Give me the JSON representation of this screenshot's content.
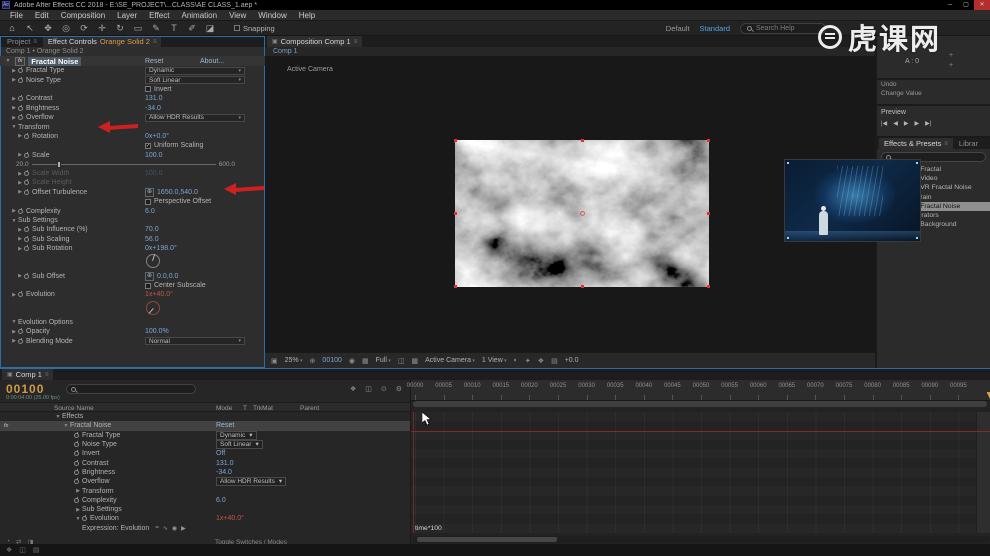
{
  "window": {
    "title": "Adobe After Effects CC 2018 - E:\\SE_PROJECT\\...CLASS\\AE CLASS_1.aep *",
    "controls": {
      "minimize": "─",
      "maximize": "▢",
      "close": "✕"
    }
  },
  "icons": {
    "menu": "≡",
    "panel": "▣",
    "twirl_open": "▼",
    "twirl_closed": "▶",
    "dropdown_arrow": "▾",
    "check": "✓",
    "point": "⊕",
    "effect_item": "◇",
    "folder_item": "▸"
  },
  "menu": {
    "items": [
      "File",
      "Edit",
      "Composition",
      "Layer",
      "Effect",
      "Animation",
      "View",
      "Window",
      "Help"
    ]
  },
  "toolbar": {
    "tools": [
      {
        "n": "home-icon",
        "g": "⌂"
      },
      {
        "n": "selection-tool-icon",
        "g": "↖"
      },
      {
        "n": "hand-tool-icon",
        "g": "✥"
      },
      {
        "n": "zoom-tool-icon",
        "g": "◎"
      },
      {
        "n": "orbit-camera-tool-icon",
        "g": "⟳"
      },
      {
        "n": "pan-camera-tool-icon",
        "g": "✛"
      },
      {
        "n": "rotate-tool-icon",
        "g": "↻"
      },
      {
        "n": "shape-tool-icon",
        "g": "▭"
      },
      {
        "n": "pen-tool-icon",
        "g": "✎"
      },
      {
        "n": "type-tool-icon",
        "g": "T"
      },
      {
        "n": "brush-tool-icon",
        "g": "✐"
      },
      {
        "n": "clone-stamp-tool-icon",
        "g": "◪"
      }
    ],
    "snapping_label": "Snapping",
    "workspace_default": "Default",
    "workspace_active": "Standard",
    "search_label": "Search Help"
  },
  "watermark": {
    "text": "虎课网"
  },
  "effect_controls": {
    "tab_project": "Project",
    "tab_effect_controls": "Effect Controls",
    "tab_target": "Orange Solid 2",
    "breadcrumb": "Comp 1 • Orange Solid 2",
    "header": {
      "badge": "fx",
      "name": "Fractal Noise",
      "reset": "Reset",
      "about": "About..."
    },
    "rows": [
      {
        "t": "dropdown",
        "label": "Fractal Type",
        "value": "Dynamic",
        "i": 1
      },
      {
        "t": "dropdown",
        "label": "Noise Type",
        "value": "Soft Linear",
        "i": 1
      },
      {
        "t": "check",
        "label": "Invert",
        "checked": false,
        "i": 1
      },
      {
        "t": "val",
        "label": "Contrast",
        "value": "131.0",
        "i": 1
      },
      {
        "t": "val",
        "label": "Brightness",
        "value": "-34.0",
        "i": 1
      },
      {
        "t": "dropdown",
        "label": "Overflow",
        "value": "Allow HDR Results",
        "i": 1
      },
      {
        "t": "group",
        "label": "Transform",
        "i": 1
      },
      {
        "t": "val",
        "label": "Rotation",
        "value": "0x+0.0°",
        "i": 2
      },
      {
        "t": "check",
        "label": "Uniform Scaling",
        "checked": true,
        "i": 2
      },
      {
        "t": "val",
        "label": "Scale",
        "value": "100.0",
        "i": 2
      },
      {
        "t": "slider",
        "min": "20.0",
        "max": "600.0",
        "pos": 14,
        "i": 2
      },
      {
        "t": "val",
        "label": "Scale Width",
        "value": "100.0",
        "disabled": true,
        "i": 2
      },
      {
        "t": "val",
        "label": "Scale Height",
        "value": "",
        "disabled": true,
        "i": 2
      },
      {
        "t": "point",
        "label": "Offset Turbulence",
        "value": "1650.0,540.0",
        "i": 2
      },
      {
        "t": "check",
        "label": "Perspective Offset",
        "checked": false,
        "i": 2
      },
      {
        "t": "val",
        "label": "Complexity",
        "value": "6.0",
        "i": 1
      },
      {
        "t": "group",
        "label": "Sub Settings",
        "i": 1
      },
      {
        "t": "val",
        "label": "Sub Influence (%)",
        "value": "70.0",
        "i": 2
      },
      {
        "t": "val",
        "label": "Sub Scaling",
        "value": "56.0",
        "i": 2
      },
      {
        "t": "val",
        "label": "Sub Rotation",
        "value": "0x+198.0°",
        "i": 2
      },
      {
        "t": "dial",
        "angle": 198,
        "i": 2
      },
      {
        "t": "point",
        "label": "Sub Offset",
        "value": "0.0,0.0",
        "i": 2
      },
      {
        "t": "check",
        "label": "Center Subscale",
        "checked": false,
        "i": 2
      },
      {
        "t": "val",
        "label": "Evolution",
        "value": "1x+40.0°",
        "red": true,
        "i": 1
      },
      {
        "t": "dial",
        "angle": 40,
        "red": true,
        "i": 1
      },
      {
        "t": "group",
        "label": "Evolution Options",
        "i": 1
      },
      {
        "t": "val",
        "label": "Opacity",
        "value": "100.0%",
        "i": 1
      },
      {
        "t": "dropdown",
        "label": "Blending Mode",
        "value": "Normal",
        "i": 1
      }
    ]
  },
  "composition": {
    "tab": "Composition Comp 1",
    "breadcrumb": "Comp 1",
    "view_label": "Active Camera",
    "bottom_items": [
      {
        "k": "icon",
        "n": "magnification-menu-icon",
        "g": "▣"
      },
      {
        "k": "text",
        "n": "zoom-level",
        "v": "25%",
        "dd": true
      },
      {
        "k": "icon",
        "n": "safe-zones-icon",
        "g": "⊕"
      },
      {
        "k": "text",
        "n": "comp-timecode",
        "v": "00100",
        "blue": true
      },
      {
        "k": "icon",
        "n": "snapshot-icon",
        "g": "◉"
      },
      {
        "k": "icon",
        "n": "channels-icon",
        "g": "▦"
      },
      {
        "k": "text",
        "n": "resolution-menu",
        "v": "Full",
        "dd": true
      },
      {
        "k": "icon",
        "n": "region-of-interest-icon",
        "g": "◫"
      },
      {
        "k": "icon",
        "n": "transparency-grid-icon",
        "g": "▩"
      },
      {
        "k": "text",
        "n": "camera-menu",
        "v": "Active Camera",
        "dd": true
      },
      {
        "k": "text",
        "n": "view-layout-menu",
        "v": "1 View",
        "dd": true
      },
      {
        "k": "icon",
        "n": "pixel-aspect-icon",
        "g": "◐"
      },
      {
        "k": "icon",
        "n": "fast-previews-icon",
        "g": "✦"
      },
      {
        "k": "icon",
        "n": "timeline-button-icon",
        "g": "❖"
      },
      {
        "k": "icon",
        "n": "flowchart-button-icon",
        "g": "▤"
      },
      {
        "k": "text",
        "n": "exposure-value",
        "v": "+0.0"
      }
    ]
  },
  "right": {
    "info": {
      "alpha": "A : 0",
      "plus1": "+",
      "plus2": "+"
    },
    "undo": {
      "line1": "Undo",
      "line2": "Change Value"
    },
    "preview": {
      "label": "Preview",
      "transport": [
        {
          "n": "first-frame-button",
          "g": "|◀"
        },
        {
          "n": "previous-frame-button",
          "g": "◀"
        },
        {
          "n": "play-button",
          "g": "▶"
        },
        {
          "n": "next-frame-button",
          "g": "▶"
        },
        {
          "n": "last-frame-button",
          "g": "▶|"
        }
      ]
    },
    "effects_presets": {
      "tab": "Effects & Presets",
      "tab_cut": "Librar",
      "items": [
        {
          "label": "Fractal",
          "indent": 2,
          "icon": "effect_item"
        },
        {
          "label": "Video",
          "indent": 2,
          "icon": "effect_item"
        },
        {
          "label": "VR Fractal Noise",
          "indent": 2,
          "icon": "effect_item"
        },
        {
          "label": "rain",
          "indent": 2,
          "icon": "effect_item"
        },
        {
          "label": "Fractal Noise",
          "indent": 2,
          "icon": "effect_item",
          "selected": true
        },
        {
          "label": "Generators",
          "indent": 1,
          "icon": "folder_item"
        },
        {
          "label": "Background",
          "indent": 2,
          "icon": "effect_item"
        }
      ]
    }
  },
  "timeline": {
    "tab": "Comp 1",
    "timecode": "00100",
    "timecode_sub": "0:00:04:00 (25.00 fps)",
    "columns": [
      "Source Name",
      "Mode",
      "T",
      "TrkMat",
      "Parent"
    ],
    "panel_icons": [
      {
        "n": "comp-mini-flowchart-icon",
        "g": "❖"
      },
      {
        "n": "draft-3d-icon",
        "g": "◫"
      },
      {
        "n": "motion-blur-icon",
        "g": "⊙"
      },
      {
        "n": "graph-editor-icon",
        "g": "⚙"
      }
    ],
    "rows": [
      {
        "label": "Effects",
        "i": 1,
        "tw": "open"
      },
      {
        "label": "Fractal Noise",
        "value": "Reset",
        "i": 2,
        "tw": "open",
        "selected": true,
        "fx": true,
        "reset": true
      },
      {
        "label": "Fractal Type",
        "value": "Dynamic",
        "dd": true,
        "sw": true,
        "i": 3
      },
      {
        "label": "Noise Type",
        "value": "Soft Linear",
        "dd": true,
        "sw": true,
        "i": 3
      },
      {
        "label": "Invert",
        "value": "Off",
        "sw": true,
        "i": 3
      },
      {
        "label": "Contrast",
        "value": "131.0",
        "sw": true,
        "i": 3
      },
      {
        "label": "Brightness",
        "value": "-34.0",
        "sw": true,
        "i": 3
      },
      {
        "label": "Overflow",
        "value": "Allow HDR Results",
        "dd": true,
        "sw": true,
        "i": 3
      },
      {
        "label": "Transform",
        "tw": "closed",
        "i": 3
      },
      {
        "label": "Complexity",
        "value": "6.0",
        "sw": true,
        "i": 3
      },
      {
        "label": "Sub Settings",
        "tw": "closed",
        "i": 3
      },
      {
        "label": "Evolution",
        "value": "1x+40.0°",
        "sw": true,
        "i": 3,
        "red": true,
        "tw": "open"
      },
      {
        "label": "Expression: Evolution",
        "i": 4,
        "expr": true
      }
    ],
    "expression_icons": [
      {
        "n": "expression-enable-icon",
        "g": "="
      },
      {
        "n": "expression-graph-icon",
        "g": "∿"
      },
      {
        "n": "expression-pickwhip-icon",
        "g": "◉"
      },
      {
        "n": "expression-language-icon",
        "g": "▶"
      }
    ],
    "expression_text": "time*100",
    "ruler_ticks": [
      "00000",
      "00005",
      "00010",
      "00015",
      "00020",
      "00025",
      "00030",
      "00035",
      "00040",
      "00045",
      "00050",
      "00055",
      "00060",
      "00065",
      "00070",
      "00075",
      "00080",
      "00085",
      "00090",
      "00095"
    ],
    "bottom_icons": [
      {
        "n": "shy-layers-icon",
        "g": "◔"
      },
      {
        "n": "frame-blend-icon",
        "g": "⇄"
      },
      {
        "n": "motion-blur-toggle-icon",
        "g": "◨"
      }
    ],
    "toggle_label": "Toggle Switches / Modes"
  },
  "statusbar": {
    "icons": [
      {
        "n": "home-status-icon",
        "g": "❖"
      },
      {
        "n": "panels-status-icon",
        "g": "◫"
      },
      {
        "n": "layers-status-icon",
        "g": "▤"
      }
    ]
  }
}
